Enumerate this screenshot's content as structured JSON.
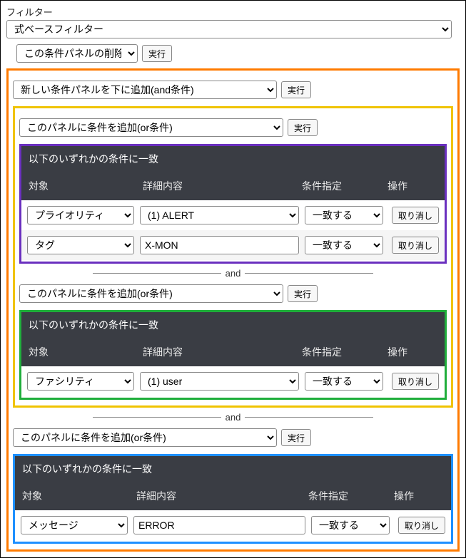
{
  "filter": {
    "label": "フィルター",
    "type_option": "式ベースフィルター",
    "delete_option": "この条件パネルの削除",
    "exec_label": "実行"
  },
  "add_and_panel": {
    "option": "新しい条件パネルを下に追加(and条件)",
    "exec_label": "実行"
  },
  "add_or": {
    "option": "このパネルに条件を追加(or条件)",
    "exec_label": "実行"
  },
  "panel_title": "以下のいずれかの条件に一致",
  "columns": {
    "target": "対象",
    "detail": "詳細内容",
    "cond": "条件指定",
    "action": "操作"
  },
  "and_label": "and",
  "cancel_label": "取り消し",
  "group_purple": {
    "rows": [
      {
        "target": "プライオリティ",
        "detail": "(1) ALERT",
        "cond": "一致する"
      },
      {
        "target": "タグ",
        "detail_text": "X-MON",
        "cond": "一致する"
      }
    ]
  },
  "group_green": {
    "rows": [
      {
        "target": "ファシリティ",
        "detail": "(1) user",
        "cond": "一致する"
      }
    ]
  },
  "group_blue": {
    "rows": [
      {
        "target": "メッセージ",
        "detail_text": "ERROR",
        "cond": "一致する"
      }
    ]
  }
}
